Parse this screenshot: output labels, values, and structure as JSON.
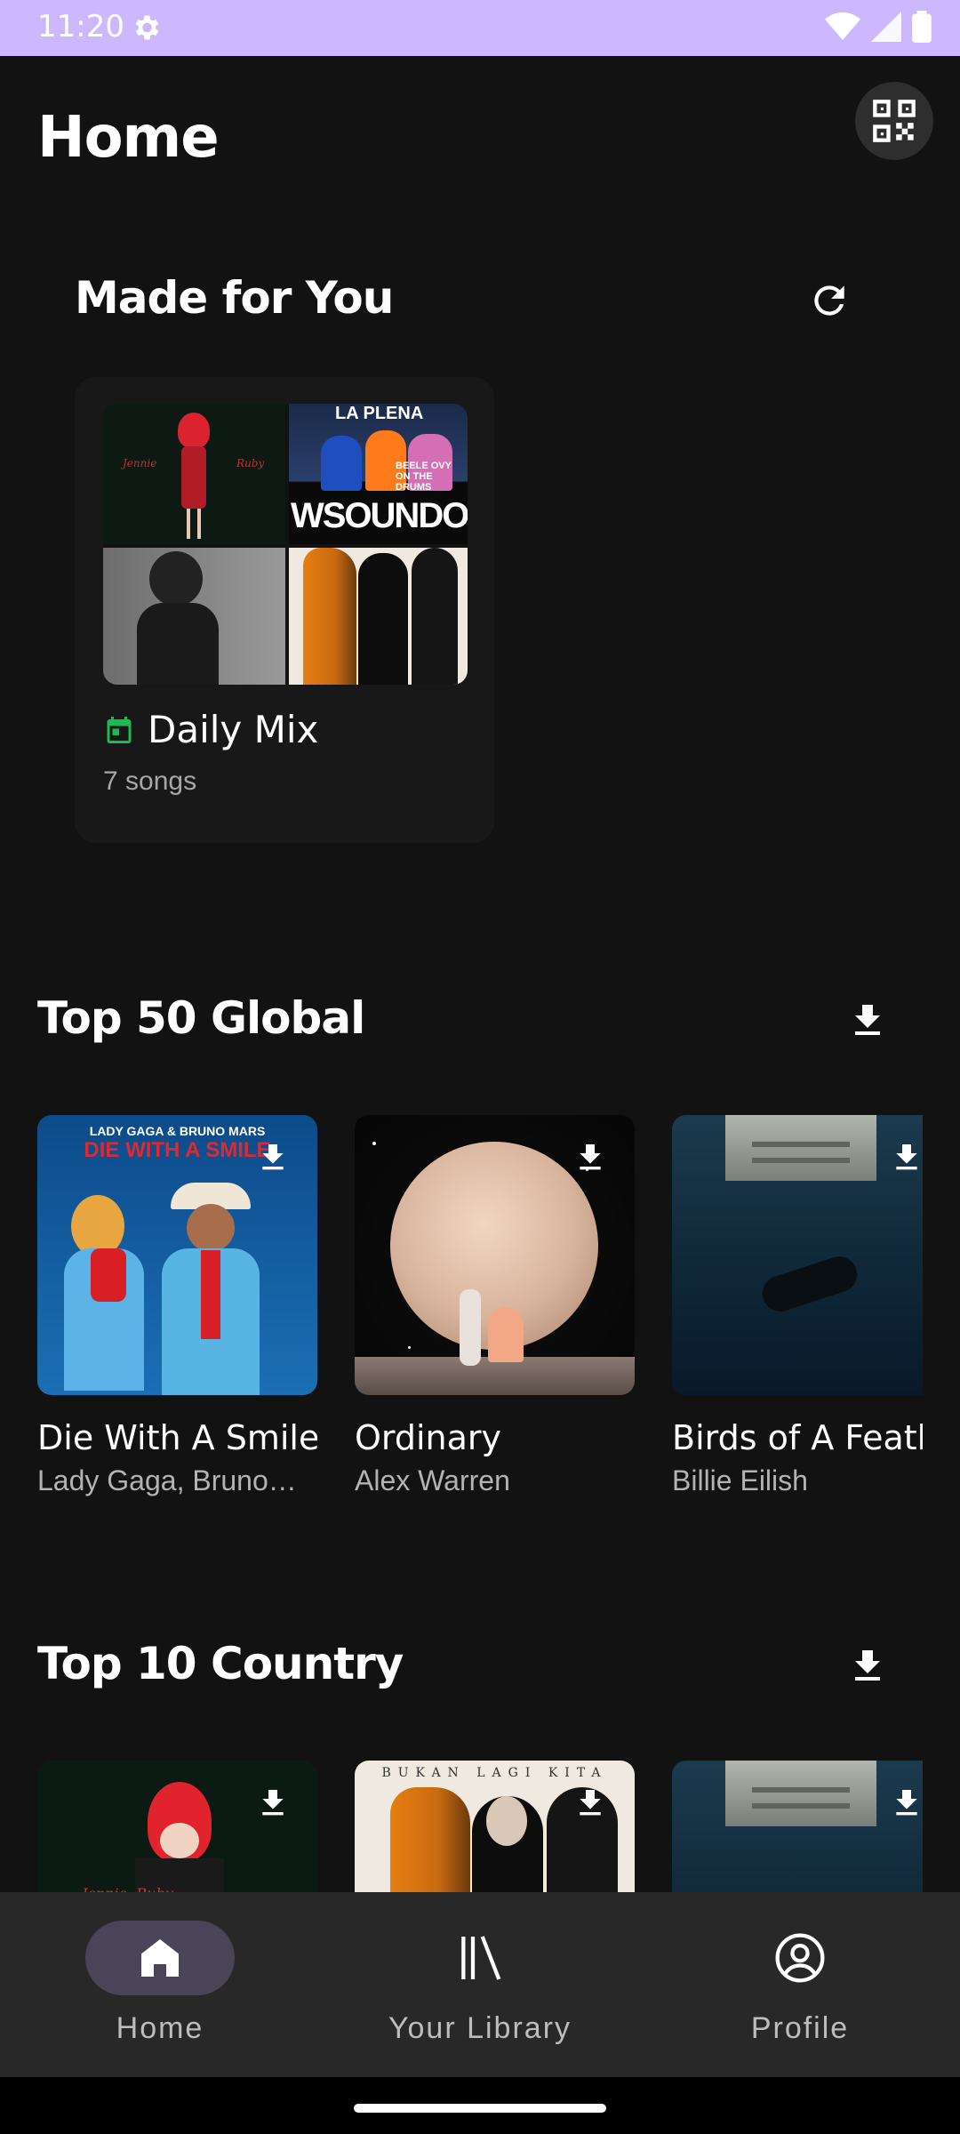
{
  "status_bar": {
    "time": "11:20"
  },
  "header": {
    "title": "Home"
  },
  "made_for_you": {
    "title": "Made for You",
    "mix": {
      "title": "Daily Mix",
      "subtitle": "7 songs"
    }
  },
  "top50": {
    "title": "Top 50 Global",
    "tracks": [
      {
        "title": "Die With A Smile",
        "artist": "Lady Gaga, Bruno Mars",
        "cover_text_top": "LADY GAGA & BRUNO MARS",
        "cover_text_main": "DIE WITH A SMILE"
      },
      {
        "title": "Ordinary",
        "artist": "Alex Warren"
      },
      {
        "title": "Birds of A Feather",
        "artist": "Billie Eilish"
      }
    ]
  },
  "top10": {
    "title": "Top 10 Country",
    "covers": [
      {
        "text": "Jennie  Ruby"
      },
      {
        "text": "BUKAN LAGI KITA"
      },
      {
        "text": ""
      }
    ]
  },
  "collage": {
    "tile2_text": "LA PLENA",
    "tile2_sub": "BEELE OVY ON THE DRUMS",
    "tile2_big": "WSOUNDOS",
    "tile1_left": "Jennie",
    "tile1_right": "Ruby"
  },
  "nav": {
    "home": "Home",
    "library": "Your Library",
    "profile": "Profile"
  },
  "colors": {
    "status_bar": "#CDB8FF",
    "accent_green": "#1DB954",
    "nav_active": "#4a4458",
    "background": "#121212"
  }
}
